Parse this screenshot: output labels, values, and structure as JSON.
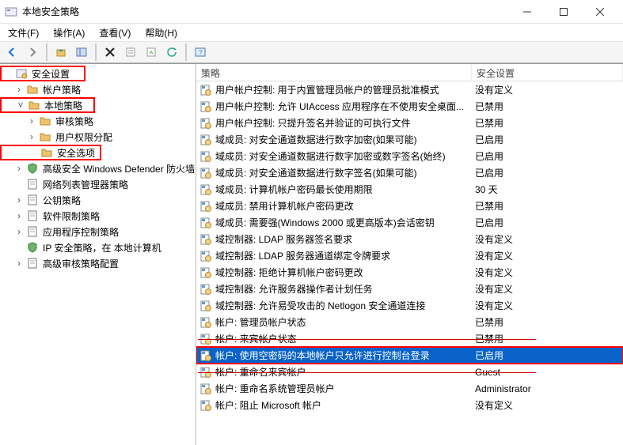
{
  "window": {
    "title": "本地安全策略"
  },
  "menu": {
    "file": "文件(F)",
    "action": "操作(A)",
    "view": "查看(V)",
    "help": "帮助(H)"
  },
  "tree": {
    "root": "安全设置",
    "items": [
      {
        "label": "帐户策略",
        "indent": 1,
        "icon": "folder",
        "twisty": ">",
        "red": false
      },
      {
        "label": "本地策略",
        "indent": 1,
        "icon": "folder",
        "twisty": "v",
        "red": true
      },
      {
        "label": "审核策略",
        "indent": 2,
        "icon": "folder",
        "twisty": ">",
        "red": false
      },
      {
        "label": "用户权限分配",
        "indent": 2,
        "icon": "folder",
        "twisty": ">",
        "red": false
      },
      {
        "label": "安全选项",
        "indent": 2,
        "icon": "folder",
        "twisty": "",
        "red": true
      },
      {
        "label": "高级安全 Windows Defender 防火墙",
        "indent": 1,
        "icon": "shield",
        "twisty": ">",
        "red": false
      },
      {
        "label": "网络列表管理器策略",
        "indent": 1,
        "icon": "page",
        "twisty": "",
        "red": false
      },
      {
        "label": "公钥策略",
        "indent": 1,
        "icon": "page",
        "twisty": ">",
        "red": false
      },
      {
        "label": "软件限制策略",
        "indent": 1,
        "icon": "page",
        "twisty": ">",
        "red": false
      },
      {
        "label": "应用程序控制策略",
        "indent": 1,
        "icon": "page",
        "twisty": ">",
        "red": false
      },
      {
        "label": "IP 安全策略，在 本地计算机",
        "indent": 1,
        "icon": "shield",
        "twisty": "",
        "red": false
      },
      {
        "label": "高级审核策略配置",
        "indent": 1,
        "icon": "page",
        "twisty": ">",
        "red": false
      }
    ]
  },
  "columns": {
    "policy": "策略",
    "setting": "安全设置"
  },
  "policies": [
    {
      "name": "用户帐户控制: 用于内置管理员帐户的管理员批准模式",
      "setting": "没有定义"
    },
    {
      "name": "用户帐户控制: 允许 UIAccess 应用程序在不使用安全桌面...",
      "setting": "已禁用"
    },
    {
      "name": "用户帐户控制: 只提升签名并验证的可执行文件",
      "setting": "已禁用"
    },
    {
      "name": "域成员: 对安全通道数据进行数字加密(如果可能)",
      "setting": "已启用"
    },
    {
      "name": "域成员: 对安全通道数据进行数字加密或数字签名(始终)",
      "setting": "已启用"
    },
    {
      "name": "域成员: 对安全通道数据进行数字签名(如果可能)",
      "setting": "已启用"
    },
    {
      "name": "域成员: 计算机帐户密码最长使用期限",
      "setting": "30 天"
    },
    {
      "name": "域成员: 禁用计算机帐户密码更改",
      "setting": "已禁用"
    },
    {
      "name": "域成员: 需要强(Windows 2000 或更高版本)会话密钥",
      "setting": "已启用"
    },
    {
      "name": "域控制器: LDAP 服务器签名要求",
      "setting": "没有定义"
    },
    {
      "name": "域控制器: LDAP 服务器通道绑定令牌要求",
      "setting": "没有定义"
    },
    {
      "name": "域控制器: 拒绝计算机帐户密码更改",
      "setting": "没有定义"
    },
    {
      "name": "域控制器: 允许服务器操作者计划任务",
      "setting": "没有定义"
    },
    {
      "name": "域控制器: 允许易受攻击的 Netlogon 安全通道连接",
      "setting": "没有定义"
    },
    {
      "name": "帐户: 管理员帐户状态",
      "setting": "已禁用"
    },
    {
      "name": "帐户: 来宾帐户状态",
      "setting": "已禁用",
      "strike": true
    },
    {
      "name": "帐户: 使用空密码的本地帐户只允许进行控制台登录",
      "setting": "已启用",
      "selected": true,
      "red": true
    },
    {
      "name": "帐户: 重命名来宾帐户",
      "setting": "Guest",
      "strike": true
    },
    {
      "name": "帐户: 重命名系统管理员帐户",
      "setting": "Administrator"
    },
    {
      "name": "帐户: 阻止 Microsoft 帐户",
      "setting": "没有定义"
    }
  ]
}
